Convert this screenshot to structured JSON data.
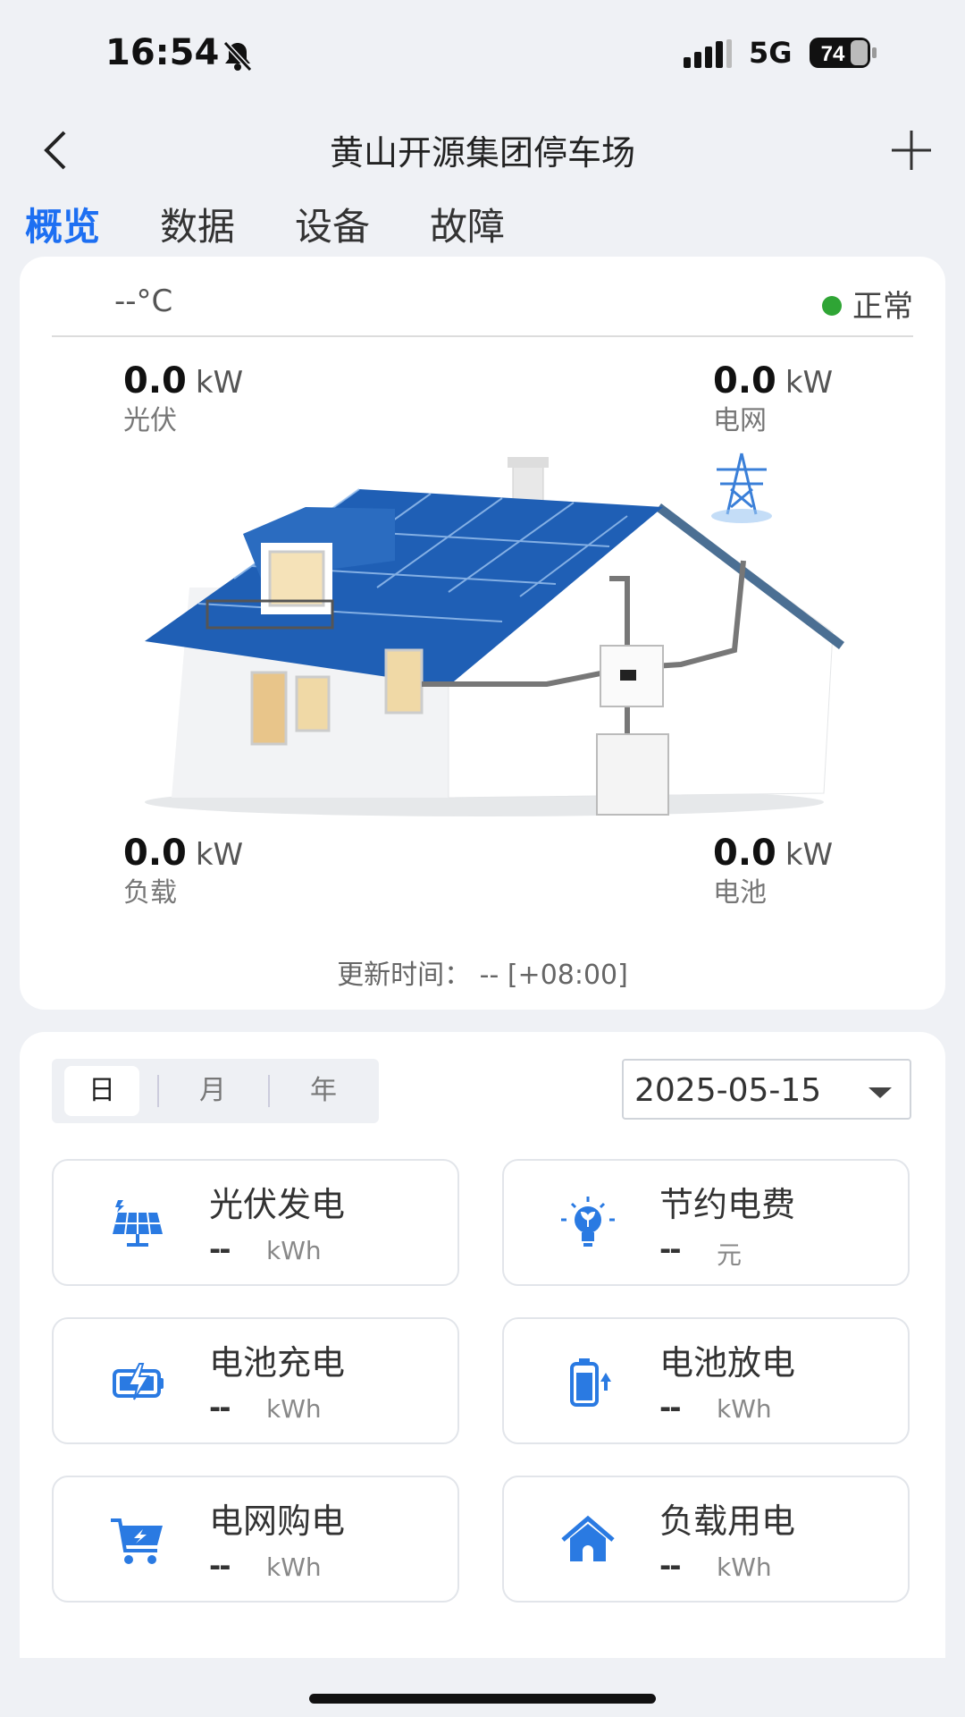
{
  "status_bar": {
    "time": "16:54",
    "network": "5G",
    "battery": "74"
  },
  "header": {
    "title": "黄山开源集团停车场"
  },
  "tabs": [
    {
      "label": "概览",
      "active": true
    },
    {
      "label": "数据",
      "active": false
    },
    {
      "label": "设备",
      "active": false
    },
    {
      "label": "故障",
      "active": false
    }
  ],
  "overview": {
    "temperature": "--°C",
    "status": "正常",
    "status_color": "#2fa535",
    "pv": {
      "value": "0.0",
      "unit": "kW",
      "label": "光伏"
    },
    "grid": {
      "value": "0.0",
      "unit": "kW",
      "label": "电网"
    },
    "load": {
      "value": "0.0",
      "unit": "kW",
      "label": "负载"
    },
    "battery": {
      "value": "0.0",
      "unit": "kW",
      "label": "电池"
    },
    "update_time": "更新时间： -- [+08:00]"
  },
  "period": {
    "options": [
      "日",
      "月",
      "年"
    ],
    "selected": "日",
    "date": "2025-05-15"
  },
  "stats": [
    {
      "name": "光伏发电",
      "value": "--",
      "unit": "kWh",
      "icon": "solar-panel-icon"
    },
    {
      "name": "节约电费",
      "value": "--",
      "unit": "元",
      "icon": "lightbulb-icon"
    },
    {
      "name": "电池充电",
      "value": "--",
      "unit": "kWh",
      "icon": "battery-charge-icon"
    },
    {
      "name": "电池放电",
      "value": "--",
      "unit": "kWh",
      "icon": "battery-discharge-icon"
    },
    {
      "name": "电网购电",
      "value": "--",
      "unit": "kWh",
      "icon": "cart-icon"
    },
    {
      "name": "负载用电",
      "value": "--",
      "unit": "kWh",
      "icon": "home-icon"
    }
  ],
  "accent_color": "#1d6ff2"
}
